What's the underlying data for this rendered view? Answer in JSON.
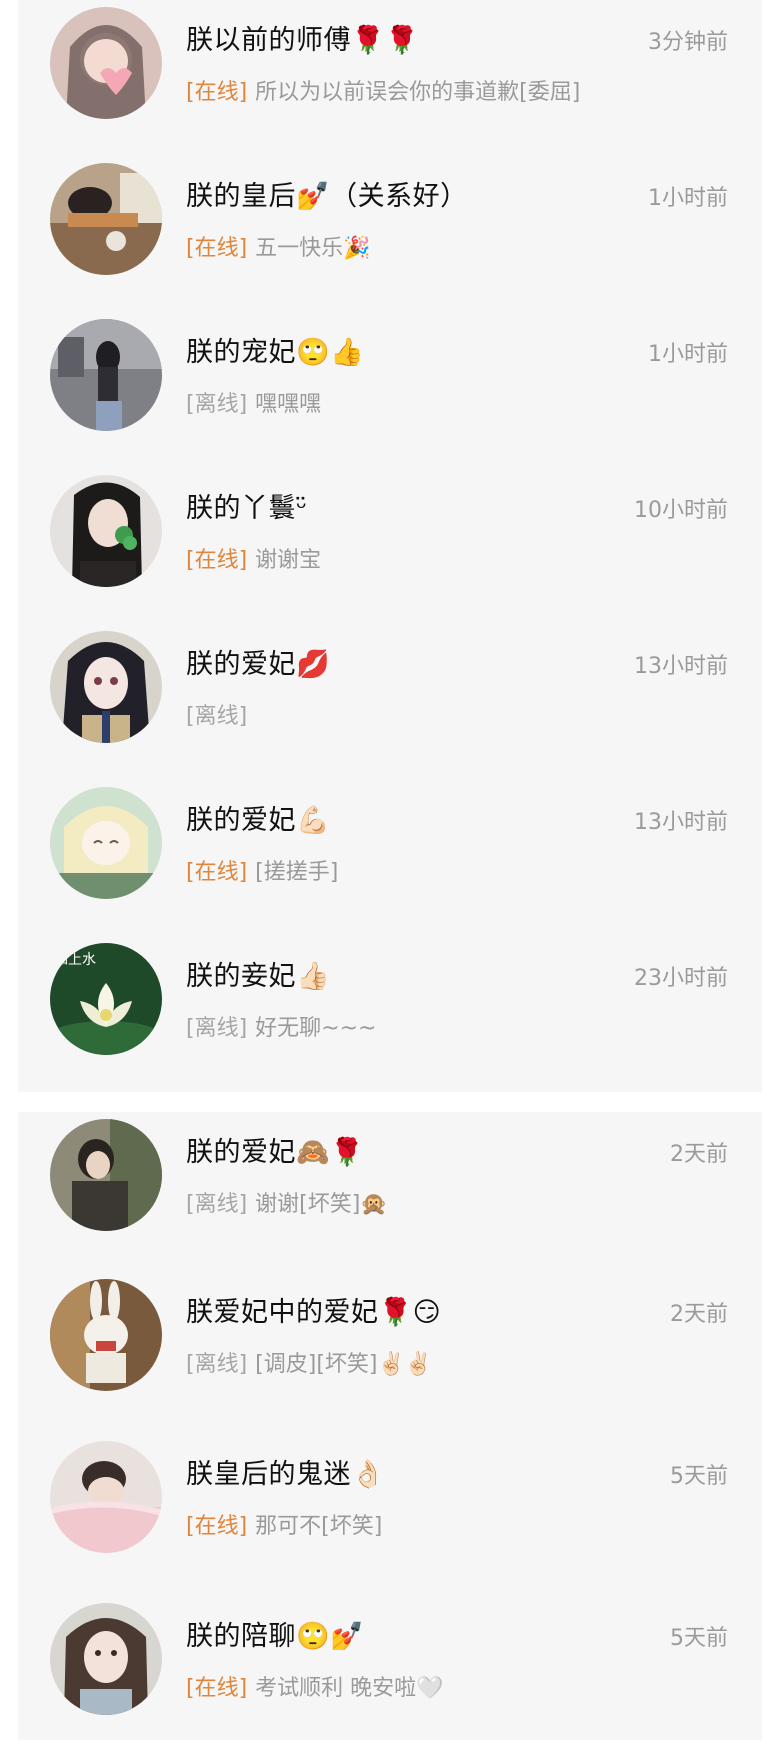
{
  "chats": [
    {
      "name": "朕以前的师傅🌹🌹",
      "time": "3分钟前",
      "status": "[在线]",
      "online": true,
      "message": "所以为以前误会你的事道歉[委屈]",
      "avatar_icon": "girl-heart-photo"
    },
    {
      "name": "朕的皇后💅（关系好）",
      "time": "1小时前",
      "status": "[在线]",
      "online": true,
      "message": "五一快乐🎉",
      "avatar_icon": "girl-desk-photo"
    },
    {
      "name": "朕的宠妃🙄👍",
      "time": "1小时前",
      "status": "[离线]",
      "online": false,
      "message": "嘿嘿嘿",
      "avatar_icon": "girl-street-photo"
    },
    {
      "name": "朕的丫鬟ᵕ̈",
      "time": "10小时前",
      "status": "[在线]",
      "online": true,
      "message": "谢谢宝",
      "avatar_icon": "girl-clover-photo"
    },
    {
      "name": "朕的爱妃💋",
      "time": "13小时前",
      "status": "[离线]",
      "online": false,
      "message": "",
      "avatar_icon": "anime-girl-photo"
    },
    {
      "name": "朕的爱妃💪🏻",
      "time": "13小时前",
      "status": "[在线]",
      "online": true,
      "message": "[搓搓手]",
      "avatar_icon": "anime-blonde-photo"
    },
    {
      "name": "朕的妾妃👍🏻",
      "time": "23小时前",
      "status": "[离线]",
      "online": false,
      "message": "好无聊~~~",
      "avatar_icon": "lotus-photo",
      "avatar_caption": "如上水"
    },
    {
      "name": "朕的爱妃🙈🌹",
      "time": "2天前",
      "status": "[离线]",
      "online": false,
      "message": "谢谢[坏笑]🙊",
      "avatar_icon": "girl-outdoor-photo"
    },
    {
      "name": "朕爱妃中的爱妃🌹😏",
      "time": "2天前",
      "status": "[离线]",
      "online": false,
      "message": "[调皮][坏笑]✌🏻✌🏻",
      "avatar_icon": "rabbid-toy-photo"
    },
    {
      "name": "朕皇后的鬼迷👌🏻",
      "time": "5天前",
      "status": "[在线]",
      "online": true,
      "message": "那可不[坏笑]",
      "avatar_icon": "girl-blanket-photo"
    },
    {
      "name": "朕的陪聊🙄💅",
      "time": "5天前",
      "status": "[在线]",
      "online": true,
      "message": "考试顺利 晚安啦🤍",
      "avatar_icon": "girl-selfie-photo"
    }
  ],
  "colors": {
    "online_status": "#e0853c",
    "offline_status": "#a6a6a6",
    "card_background": "#f6f6f7",
    "name_text": "#111111",
    "meta_text": "#9a9a9a"
  }
}
